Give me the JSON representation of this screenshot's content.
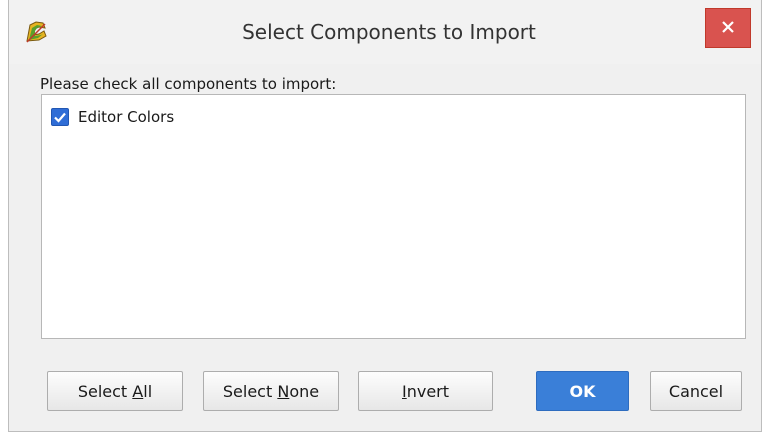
{
  "window": {
    "title": "Select Components to Import",
    "close_symbol": "×",
    "app_icon": "app-logo-icon"
  },
  "main": {
    "prompt": "Please check all components to import:",
    "components": [
      {
        "label": "Editor Colors",
        "checked": true
      }
    ]
  },
  "buttons": {
    "select_all": {
      "pre": "Select ",
      "mnemonic": "A",
      "post": "ll"
    },
    "select_none": {
      "pre": "Select ",
      "mnemonic": "N",
      "post": "one"
    },
    "invert": {
      "pre": "",
      "mnemonic": "I",
      "post": "nvert"
    },
    "ok": "OK",
    "cancel": "Cancel"
  },
  "colors": {
    "accent": "#3a7fd8",
    "close_button": "#d9534f"
  }
}
